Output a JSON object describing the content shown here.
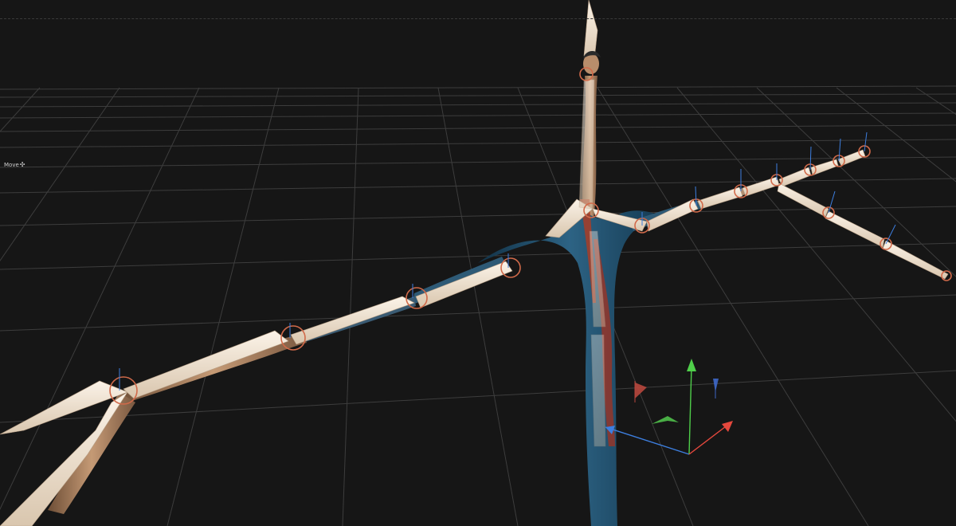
{
  "viewport": {
    "background_color": "#161616",
    "grid_color": "#3d3d3d",
    "active_tool": {
      "label": "Move",
      "icon": "move-arrows-icon",
      "glyph": "✣"
    }
  },
  "colors": {
    "skin_mesh": "#a97f5e",
    "cloth_mesh": "#24506b",
    "cloth_highlight": "#c4452a",
    "bone": "#ecdcc8",
    "joint_ring": "#d16a4a",
    "axis_x": "#e5483d",
    "axis_y": "#4fcf4a",
    "axis_z": "#3d7fe0"
  },
  "manipulator": {
    "icon": "transform-gizmo-icon",
    "axes": [
      "x",
      "y",
      "z"
    ]
  }
}
